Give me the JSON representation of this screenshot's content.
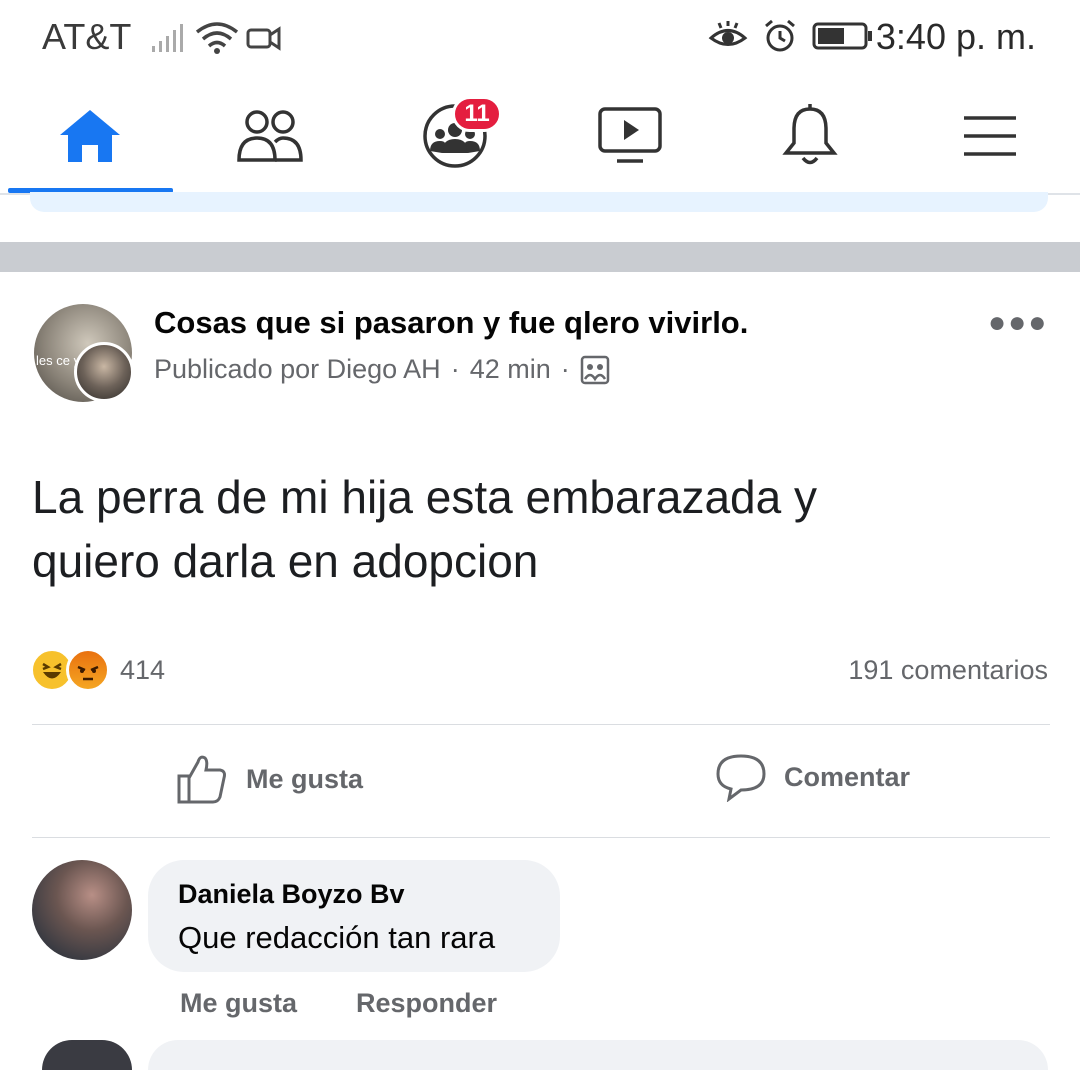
{
  "status_bar": {
    "carrier": "AT&T",
    "time": "3:40 p. m.",
    "icons_left": [
      "signal-icon",
      "wifi-icon",
      "video-icon"
    ],
    "icons_right": [
      "eye-icon",
      "alarm-icon",
      "battery-icon"
    ]
  },
  "nav": {
    "items": [
      "home-icon",
      "friends-icon",
      "groups-icon",
      "watch-icon",
      "bell-icon",
      "menu-icon"
    ],
    "active": "home-icon",
    "groups_badge": "11",
    "accent": "#1877f2"
  },
  "post": {
    "group_name": "Cosas que si pasaron y fue qlero vivirlo.",
    "posted_by": "Publicado por Diego AH",
    "time": "42 min",
    "avatar_text": "les ce ya n",
    "text_line1": "La perra de mi hija esta embarazada y",
    "text_line2": "quiero darla en adopcion",
    "reaction_count": "414",
    "comment_count": "191 comentarios",
    "like_label": "Me gusta",
    "comment_label": "Comentar"
  },
  "comment": {
    "author": "Daniela Boyzo Bv",
    "text": "Que redacción tan rara",
    "like_label": "Me gusta",
    "reply_label": "Responder"
  }
}
